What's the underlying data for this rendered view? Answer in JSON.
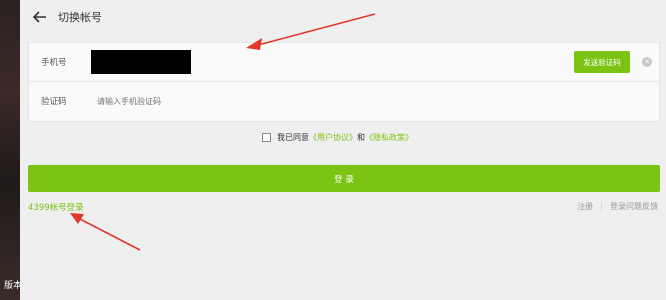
{
  "header": {
    "title": "切换帐号"
  },
  "form": {
    "phone_label": "手机号",
    "send_code_label": "发送验证码",
    "clear_icon": "✕",
    "code_label": "验证码",
    "code_placeholder": "请输入手机验证码"
  },
  "agreement": {
    "prefix": "我已同意",
    "user_agreement": "《用户协议》",
    "and": "和",
    "privacy_policy": "《隐私政策》"
  },
  "login_label": "登 录",
  "account_login_label": "4399帐号登录",
  "register_label": "注册",
  "separator": "|",
  "feedback_label": "登录问题反馈",
  "background_text": "版本",
  "colors": {
    "accent": "#7cc414",
    "annotation_arrow": "#e0392b"
  },
  "icons": {
    "back": "back-arrow-icon",
    "clear": "clear-icon",
    "checkbox": "checkbox-icon"
  }
}
